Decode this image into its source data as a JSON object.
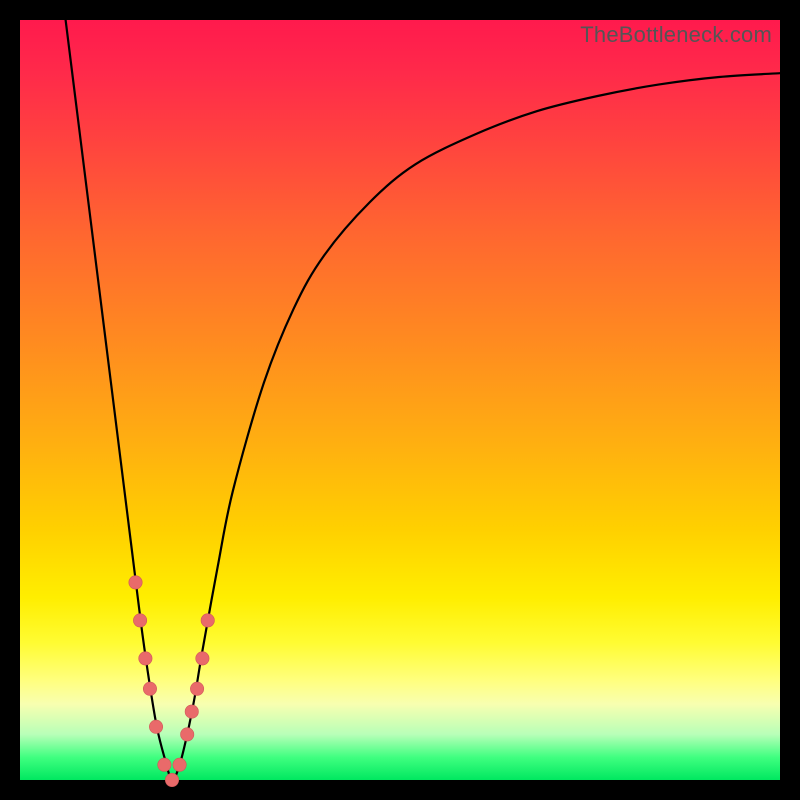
{
  "watermark": "TheBottleneck.com",
  "colors": {
    "background": "#000000",
    "curve": "#000000",
    "marker_fill": "#e96a6a",
    "marker_stroke": "#d05858",
    "gradient_top": "#ff1a4d",
    "gradient_bottom": "#00e860"
  },
  "chart_data": {
    "type": "line",
    "title": "",
    "xlabel": "",
    "ylabel": "",
    "xlim": [
      0,
      100
    ],
    "ylim": [
      0,
      100
    ],
    "grid": false,
    "legend": false,
    "description": "Bottleneck-style V curve with minimum near x≈20; gradient background red→green top→bottom. y≈0 is optimal (green), y≈100 is worst (red).",
    "series": [
      {
        "name": "curve",
        "x": [
          6,
          8,
          10,
          12,
          14,
          15,
          16,
          17,
          18,
          19,
          20,
          21,
          22,
          23,
          24,
          26,
          28,
          32,
          36,
          40,
          46,
          52,
          60,
          68,
          76,
          84,
          92,
          100
        ],
        "y": [
          100,
          84,
          68,
          52,
          36,
          28,
          20,
          13,
          7,
          3,
          0,
          2,
          6,
          11,
          17,
          28,
          38,
          52,
          62,
          69,
          76,
          81,
          85,
          88,
          90,
          91.5,
          92.5,
          93
        ]
      }
    ],
    "markers": {
      "name": "highlighted-points",
      "x": [
        15.2,
        15.8,
        16.5,
        17.1,
        17.9,
        19.0,
        20.0,
        21.0,
        22.0,
        22.6,
        23.3,
        24.0,
        24.7
      ],
      "y": [
        26,
        21,
        16,
        12,
        7,
        2,
        0,
        2,
        6,
        9,
        12,
        16,
        21
      ],
      "r": 8
    }
  }
}
